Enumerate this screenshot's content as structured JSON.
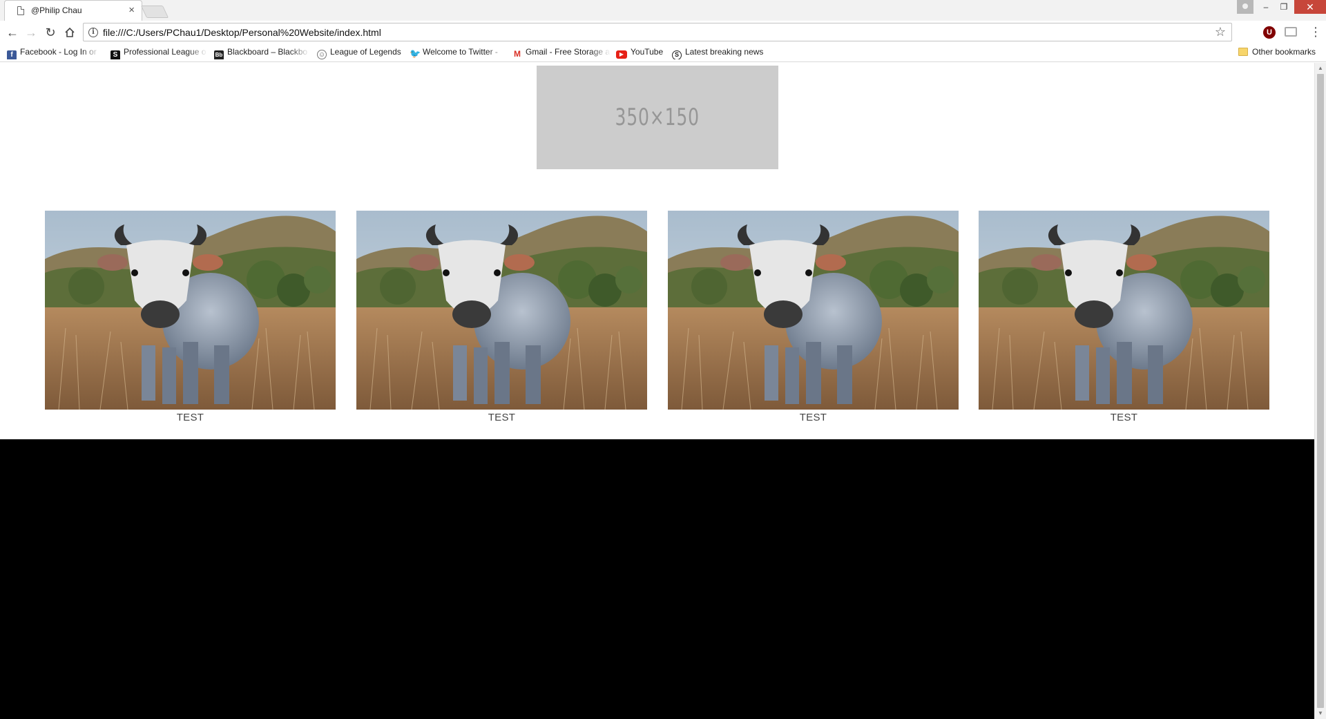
{
  "browser": {
    "tab_title": "@Philip Chau",
    "tab_close_glyph": "×",
    "url": "file:///C:/Users/PChau1/Desktop/Personal%20Website/index.html",
    "icons": [
      "page-icon",
      "back-icon",
      "forward-icon",
      "reload-icon",
      "home-icon",
      "info-icon",
      "star-icon",
      "ublock-icon",
      "cast-icon",
      "menu-icon",
      "folder-icon"
    ],
    "bookmarks": [
      {
        "label": "Facebook - Log In or",
        "icon": "facebook-icon",
        "glyph": "f"
      },
      {
        "label": "Professional League o",
        "icon": "league-icon",
        "glyph": "S"
      },
      {
        "label": "Blackboard – Blackbo",
        "icon": "blackboard-icon",
        "glyph": "Bb"
      },
      {
        "label": "League of Legends",
        "icon": "lol-icon",
        "glyph": "☺"
      },
      {
        "label": "Welcome to Twitter -",
        "icon": "twitter-icon",
        "glyph": "🐦"
      },
      {
        "label": "Gmail - Free Storage a",
        "icon": "gmail-icon",
        "glyph": "M"
      },
      {
        "label": "YouTube",
        "icon": "youtube-icon",
        "glyph": "▶"
      },
      {
        "label": "Latest breaking news",
        "icon": "news-icon",
        "glyph": "S"
      }
    ],
    "other_bookmarks": "Other bookmarks",
    "ublock_glyph": "U",
    "window_controls": {
      "minimize": "–",
      "maximize": "❐",
      "close": "✕"
    }
  },
  "page": {
    "hero_placeholder_text": "350×150",
    "gallery": [
      {
        "caption": "TEST",
        "image": "bull-in-field-photo"
      },
      {
        "caption": "TEST",
        "image": "bull-in-field-photo"
      },
      {
        "caption": "TEST",
        "image": "bull-in-field-photo"
      },
      {
        "caption": "TEST",
        "image": "bull-in-field-photo"
      }
    ],
    "colors": {
      "placeholder_bg": "#cccccc",
      "footer_bg": "#000000",
      "close_button": "#c7463a"
    }
  }
}
